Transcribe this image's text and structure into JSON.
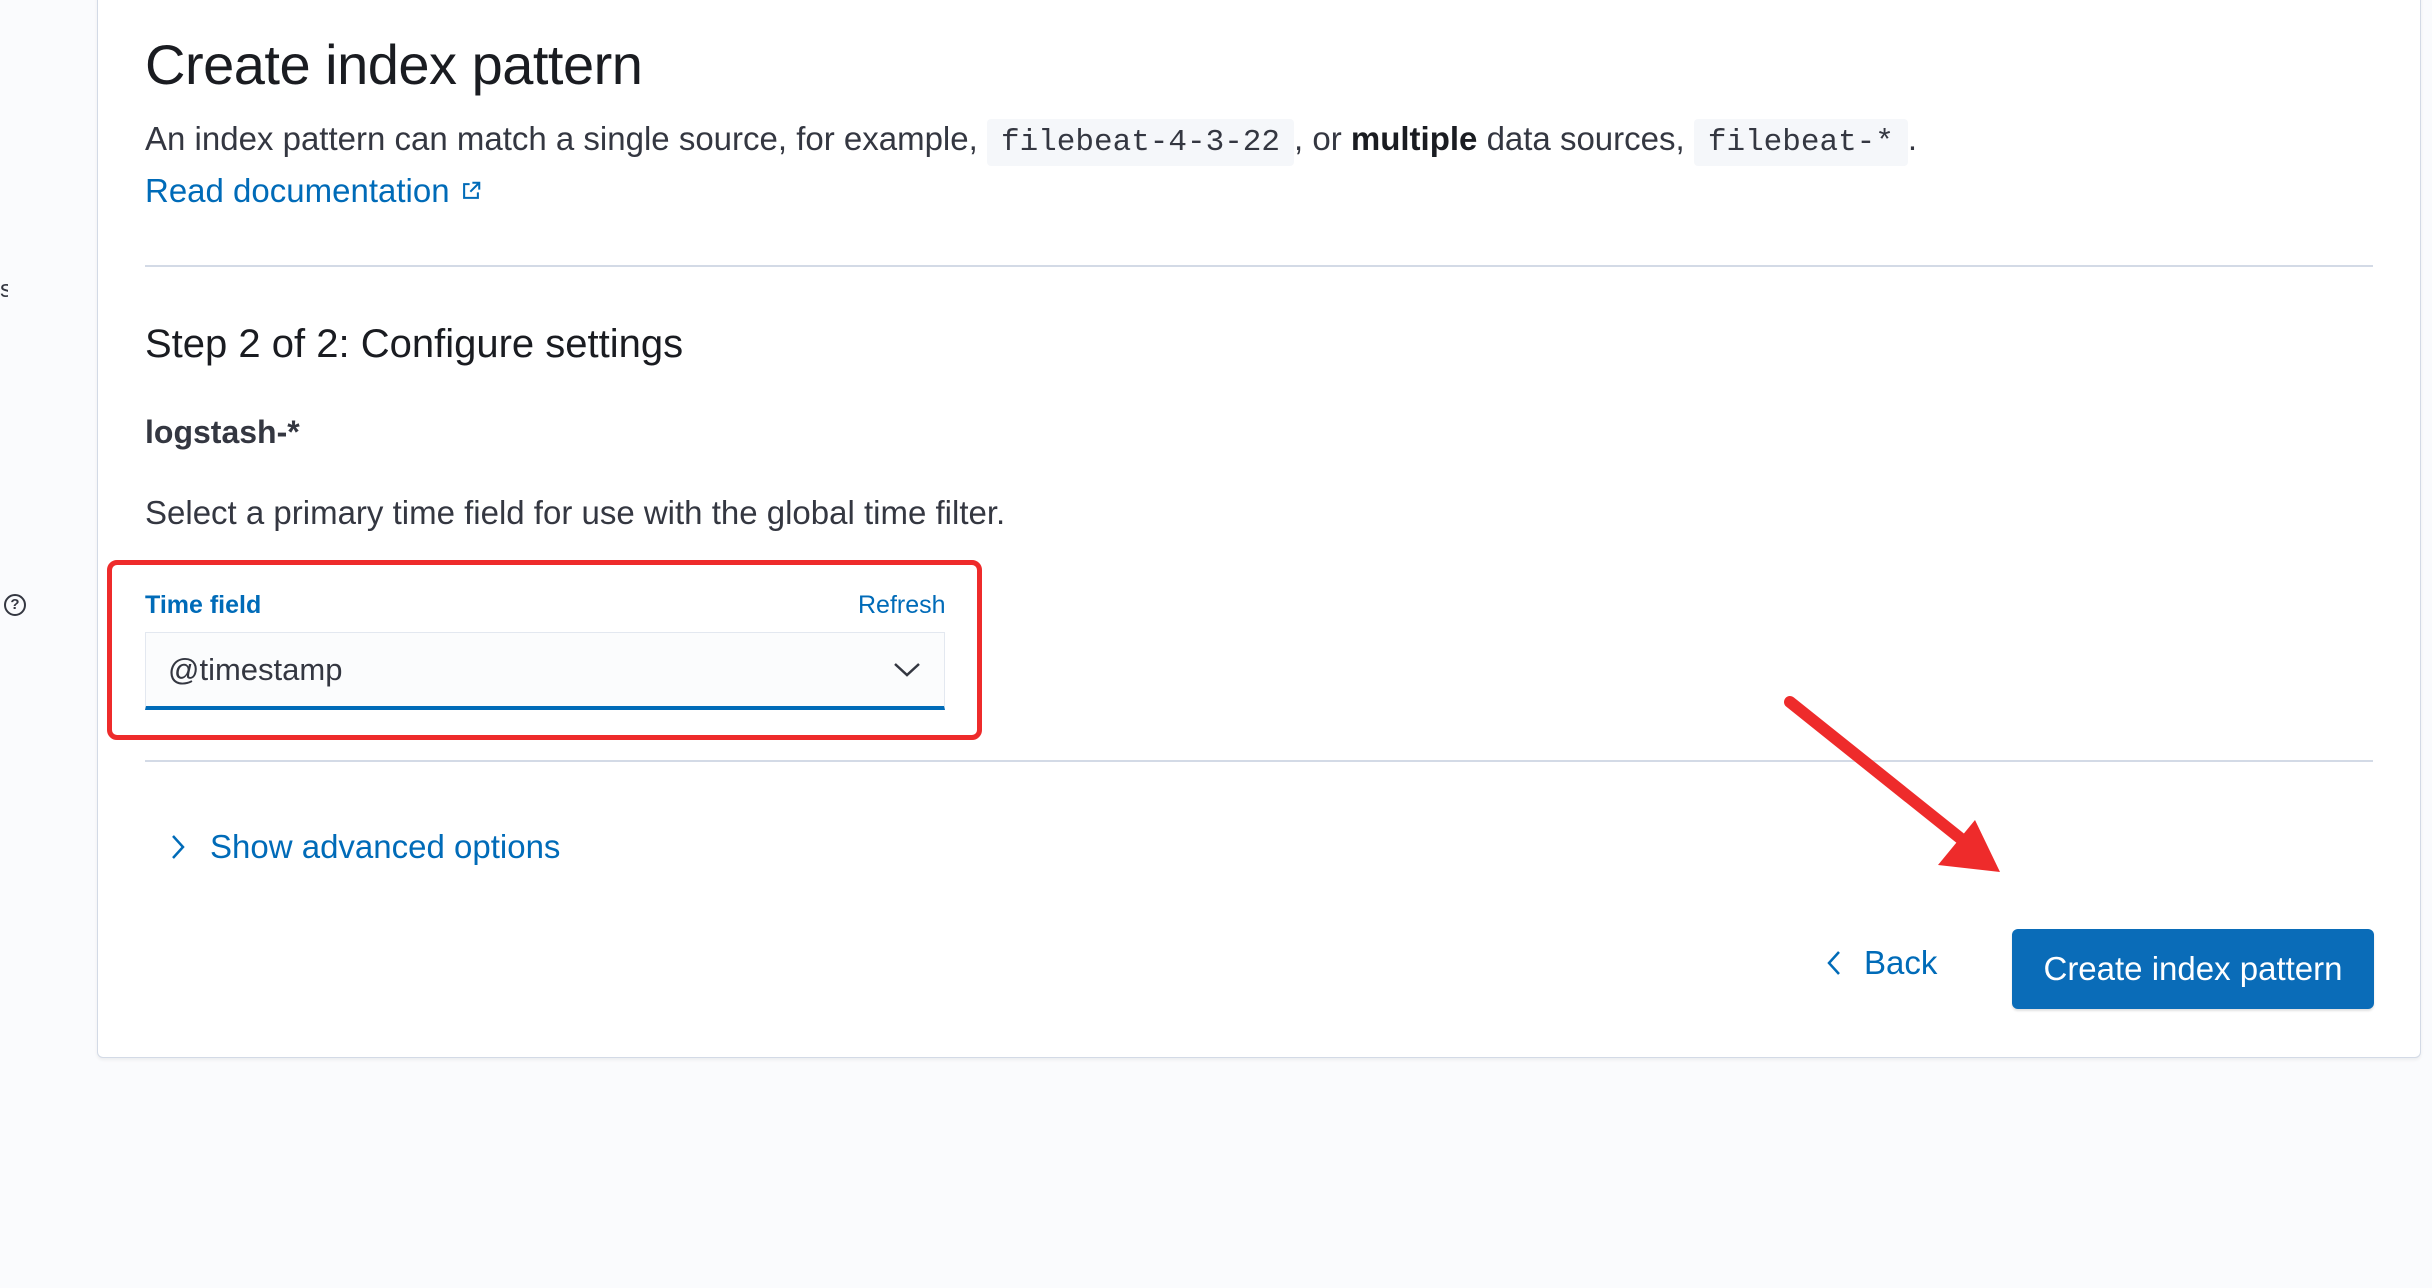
{
  "page": {
    "title": "Create index pattern",
    "intro": {
      "part1": "An index pattern can match a single source, for example,",
      "example_single": "filebeat-4-3-22",
      "part2": ", or",
      "emphasis": "multiple",
      "part3": "data sources,",
      "example_multiple": "filebeat-*",
      "part4": "."
    },
    "doc_link": "Read documentation"
  },
  "step": {
    "title": "Step 2 of 2: Configure settings",
    "index_pattern": "logstash-*",
    "time_description": "Select a primary time field for use with the global time filter."
  },
  "time_field": {
    "label": "Time field",
    "refresh": "Refresh",
    "selected": "@timestamp"
  },
  "advanced": {
    "label": "Show advanced options"
  },
  "actions": {
    "back": "Back",
    "create": "Create index pattern"
  },
  "annotations": {
    "highlight_color": "#ee2b2b"
  },
  "colors": {
    "accent": "#006bb8",
    "primary_button": "#0a6cb8"
  }
}
